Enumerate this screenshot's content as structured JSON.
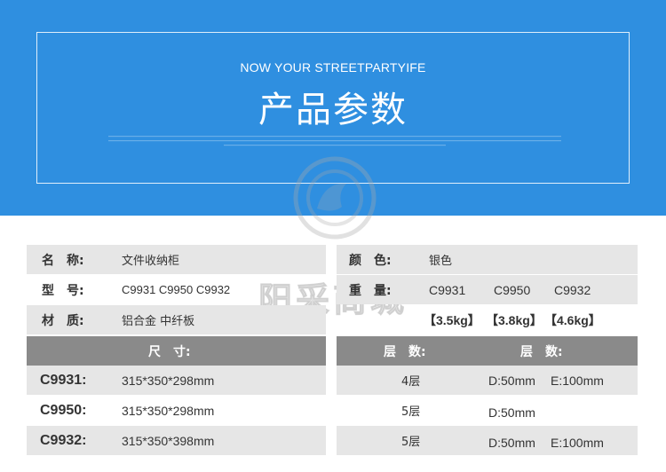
{
  "banner": {
    "subtitle": "NOW YOUR STREETPARTYIFE",
    "title": "产品参数"
  },
  "watermark": {
    "text": "阳采商城"
  },
  "specs": {
    "name_label": "名　称:",
    "name_value": "文件收纳柜",
    "model_label": "型　号:",
    "model_value": "C9931  C9950  C9932",
    "material_label": "材　质:",
    "material_value": "铝合金  中纤板",
    "color_label": "颜　色:",
    "color_value": "银色",
    "weight_label": "重　量:",
    "weight_models": [
      "C9931",
      "C9950",
      "C9932"
    ],
    "weights": [
      "【3.5kg】",
      "【3.8kg】",
      "【4.6kg】"
    ]
  },
  "table": {
    "size_header": "尺　寸:",
    "layers_header_1": "层　数:",
    "layers_header_2": "层　数:",
    "rows": [
      {
        "code": "C9931:",
        "size": "315*350*298mm",
        "layers": "4层",
        "d": "D:50mm",
        "e": "E:100mm"
      },
      {
        "code": "C9950:",
        "size": "315*350*298mm",
        "layers": "5层",
        "d": "D:50mm",
        "e": ""
      },
      {
        "code": "C9932:",
        "size": "315*350*398mm",
        "layers": "5层",
        "d": "D:50mm",
        "e": "E:100mm"
      }
    ]
  }
}
